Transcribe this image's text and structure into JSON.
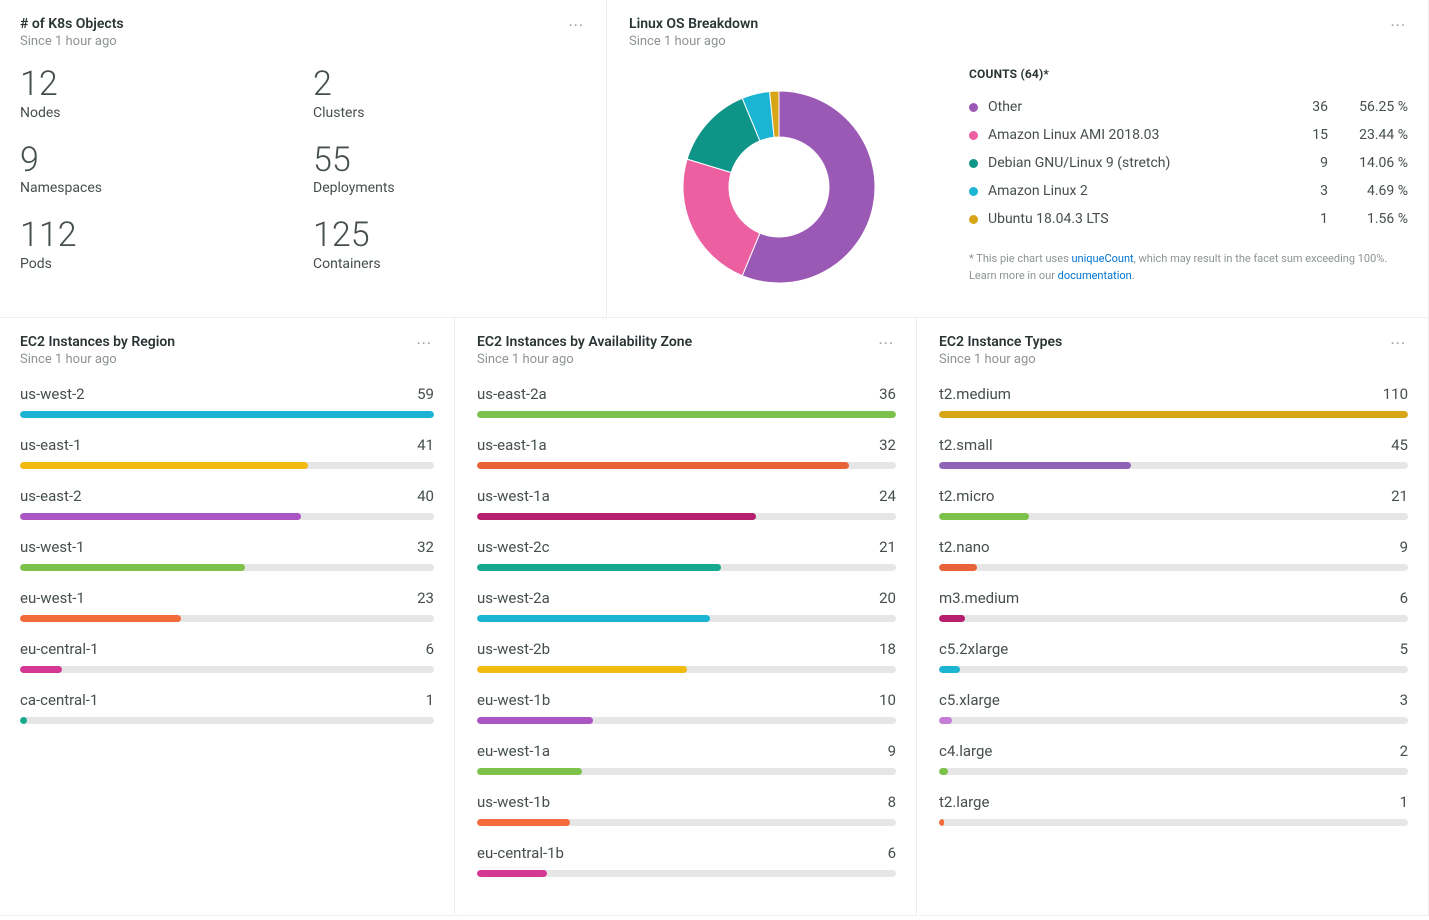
{
  "k8s": {
    "title": "# of K8s Objects",
    "subtitle": "Since 1 hour ago",
    "metrics": [
      {
        "value": "12",
        "label": "Nodes"
      },
      {
        "value": "2",
        "label": "Clusters"
      },
      {
        "value": "9",
        "label": "Namespaces"
      },
      {
        "value": "55",
        "label": "Deployments"
      },
      {
        "value": "112",
        "label": "Pods"
      },
      {
        "value": "125",
        "label": "Containers"
      }
    ]
  },
  "os": {
    "title": "Linux OS Breakdown",
    "subtitle": "Since 1 hour ago",
    "legend_title": "COUNTS (64)*",
    "note_prefix": "* This pie chart uses ",
    "note_link1": "uniqueCount",
    "note_mid": ", which may result in the facet sum exceeding 100%. Learn more in our ",
    "note_link2": "documentation",
    "note_suffix": ".",
    "items": [
      {
        "name": "Other",
        "count": 36,
        "pct": "56.25 %",
        "color": "#9b59b6"
      },
      {
        "name": "Amazon Linux AMI 2018.03",
        "count": 15,
        "pct": "23.44 %",
        "color": "#ec5fa1"
      },
      {
        "name": "Debian GNU/Linux 9 (stretch)",
        "count": 9,
        "pct": "14.06 %",
        "color": "#0f9488"
      },
      {
        "name": "Amazon Linux 2",
        "count": 3,
        "pct": "4.69 %",
        "color": "#1bb4d3"
      },
      {
        "name": "Ubuntu 18.04.3 LTS",
        "count": 1,
        "pct": "1.56 %",
        "color": "#d6a616"
      }
    ]
  },
  "region": {
    "title": "EC2 Instances by Region",
    "subtitle": "Since 1 hour ago",
    "max": 59,
    "items": [
      {
        "name": "us-west-2",
        "value": 59,
        "color": "#1bb4d3"
      },
      {
        "name": "us-east-1",
        "value": 41,
        "color": "#f2b90f"
      },
      {
        "name": "us-east-2",
        "value": 40,
        "color": "#ab54c4"
      },
      {
        "name": "us-west-1",
        "value": 32,
        "color": "#7cc24a"
      },
      {
        "name": "eu-west-1",
        "value": 23,
        "color": "#f36b3b"
      },
      {
        "name": "eu-central-1",
        "value": 6,
        "color": "#d53893"
      },
      {
        "name": "ca-central-1",
        "value": 1,
        "color": "#17a990"
      }
    ]
  },
  "az": {
    "title": "EC2 Instances by Availability Zone",
    "subtitle": "Since 1 hour ago",
    "max": 36,
    "items": [
      {
        "name": "us-east-2a",
        "value": 36,
        "color": "#7cc24a"
      },
      {
        "name": "us-east-1a",
        "value": 32,
        "color": "#e86438"
      },
      {
        "name": "us-west-1a",
        "value": 24,
        "color": "#b61e6e"
      },
      {
        "name": "us-west-2c",
        "value": 21,
        "color": "#17a990"
      },
      {
        "name": "us-west-2a",
        "value": 20,
        "color": "#1bb4d3"
      },
      {
        "name": "us-west-2b",
        "value": 18,
        "color": "#f2b90f"
      },
      {
        "name": "eu-west-1b",
        "value": 10,
        "color": "#ab54c4"
      },
      {
        "name": "eu-west-1a",
        "value": 9,
        "color": "#7cc24a"
      },
      {
        "name": "us-west-1b",
        "value": 8,
        "color": "#f36b3b"
      },
      {
        "name": "eu-central-1b",
        "value": 6,
        "color": "#d53893"
      }
    ]
  },
  "types": {
    "title": "EC2 Instance Types",
    "subtitle": "Since 1 hour ago",
    "max": 110,
    "items": [
      {
        "name": "t2.medium",
        "value": 110,
        "color": "#d6a616"
      },
      {
        "name": "t2.small",
        "value": 45,
        "color": "#8f63b8"
      },
      {
        "name": "t2.micro",
        "value": 21,
        "color": "#7cc24a"
      },
      {
        "name": "t2.nano",
        "value": 9,
        "color": "#e8623a"
      },
      {
        "name": "m3.medium",
        "value": 6,
        "color": "#b61e6e"
      },
      {
        "name": "c5.2xlarge",
        "value": 5,
        "color": "#1bb4d3"
      },
      {
        "name": "c5.xlarge",
        "value": 3,
        "color": "#c57ed8"
      },
      {
        "name": "c4.large",
        "value": 2,
        "color": "#7cc24a"
      },
      {
        "name": "t2.large",
        "value": 1,
        "color": "#f36b3b"
      }
    ]
  },
  "chart_data": [
    {
      "type": "table",
      "title": "# of K8s Objects",
      "series": [
        {
          "name": "Nodes",
          "value": 12
        },
        {
          "name": "Clusters",
          "value": 2
        },
        {
          "name": "Namespaces",
          "value": 9
        },
        {
          "name": "Deployments",
          "value": 55
        },
        {
          "name": "Pods",
          "value": 112
        },
        {
          "name": "Containers",
          "value": 125
        }
      ]
    },
    {
      "type": "pie",
      "title": "Linux OS Breakdown",
      "categories": [
        "Other",
        "Amazon Linux AMI 2018.03",
        "Debian GNU/Linux 9 (stretch)",
        "Amazon Linux 2",
        "Ubuntu 18.04.3 LTS"
      ],
      "values": [
        36,
        15,
        9,
        3,
        1
      ]
    },
    {
      "type": "bar",
      "title": "EC2 Instances by Region",
      "categories": [
        "us-west-2",
        "us-east-1",
        "us-east-2",
        "us-west-1",
        "eu-west-1",
        "eu-central-1",
        "ca-central-1"
      ],
      "values": [
        59,
        41,
        40,
        32,
        23,
        6,
        1
      ]
    },
    {
      "type": "bar",
      "title": "EC2 Instances by Availability Zone",
      "categories": [
        "us-east-2a",
        "us-east-1a",
        "us-west-1a",
        "us-west-2c",
        "us-west-2a",
        "us-west-2b",
        "eu-west-1b",
        "eu-west-1a",
        "us-west-1b",
        "eu-central-1b"
      ],
      "values": [
        36,
        32,
        24,
        21,
        20,
        18,
        10,
        9,
        8,
        6
      ]
    },
    {
      "type": "bar",
      "title": "EC2 Instance Types",
      "categories": [
        "t2.medium",
        "t2.small",
        "t2.micro",
        "t2.nano",
        "m3.medium",
        "c5.2xlarge",
        "c5.xlarge",
        "c4.large",
        "t2.large"
      ],
      "values": [
        110,
        45,
        21,
        9,
        6,
        5,
        3,
        2,
        1
      ]
    }
  ]
}
